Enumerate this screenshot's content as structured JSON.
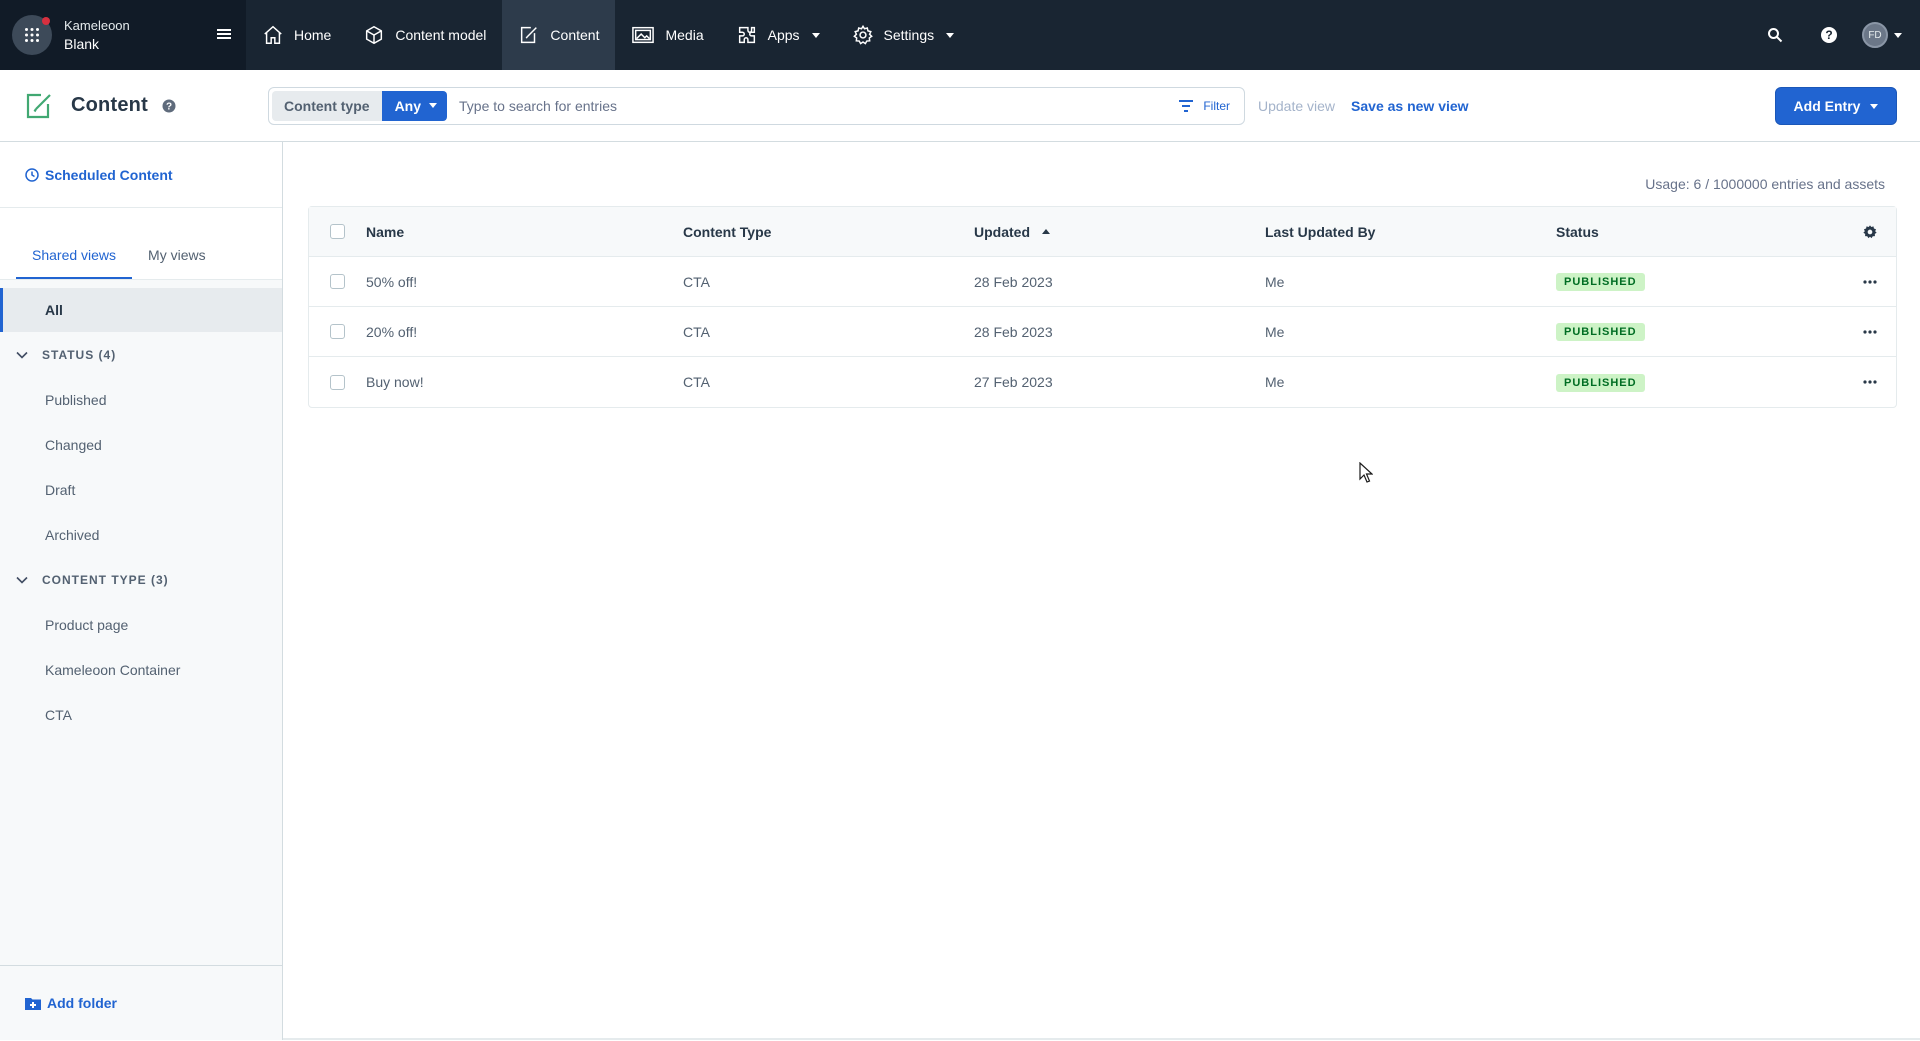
{
  "space": {
    "org": "Kameleoon",
    "environment": "Blank"
  },
  "nav": [
    {
      "label": "Home",
      "icon": "home-icon",
      "active": false,
      "dropdown": false
    },
    {
      "label": "Content model",
      "icon": "content-model-icon",
      "active": false,
      "dropdown": false
    },
    {
      "label": "Content",
      "icon": "content-icon",
      "active": true,
      "dropdown": false
    },
    {
      "label": "Media",
      "icon": "media-icon",
      "active": false,
      "dropdown": false
    },
    {
      "label": "Apps",
      "icon": "apps-icon",
      "active": false,
      "dropdown": true
    },
    {
      "label": "Settings",
      "icon": "gear-icon",
      "active": false,
      "dropdown": true
    }
  ],
  "user": {
    "initials": "FD"
  },
  "header": {
    "title": "Content",
    "content_type_label": "Content type",
    "content_type_value": "Any",
    "search_placeholder": "Type to search for entries",
    "filter_label": "Filter",
    "update_view": "Update view",
    "save_as_new_view": "Save as new view",
    "add_entry": "Add Entry"
  },
  "sidebar": {
    "scheduled": "Scheduled Content",
    "tabs": [
      "Shared views",
      "My views"
    ],
    "all": "All",
    "status_folder": "STATUS (4)",
    "status_items": [
      "Published",
      "Changed",
      "Draft",
      "Archived"
    ],
    "type_folder": "CONTENT TYPE (3)",
    "type_items": [
      "Product page",
      "Kameleoon Container",
      "CTA"
    ],
    "add_folder": "Add folder"
  },
  "usage": "Usage: 6 / 1000000 entries and assets",
  "table": {
    "columns": [
      "Name",
      "Content Type",
      "Updated",
      "Last Updated By",
      "Status"
    ],
    "rows": [
      {
        "name": "50% off!",
        "type": "CTA",
        "updated": "28 Feb 2023",
        "by": "Me",
        "status": "PUBLISHED"
      },
      {
        "name": "20% off!",
        "type": "CTA",
        "updated": "28 Feb 2023",
        "by": "Me",
        "status": "PUBLISHED"
      },
      {
        "name": "Buy now!",
        "type": "CTA",
        "updated": "27 Feb 2023",
        "by": "Me",
        "status": "PUBLISHED"
      }
    ]
  },
  "colors": {
    "topbar": "#192532",
    "accent": "#2164d1",
    "published_bg": "#cdf3c6",
    "published_text": "#006d23"
  }
}
